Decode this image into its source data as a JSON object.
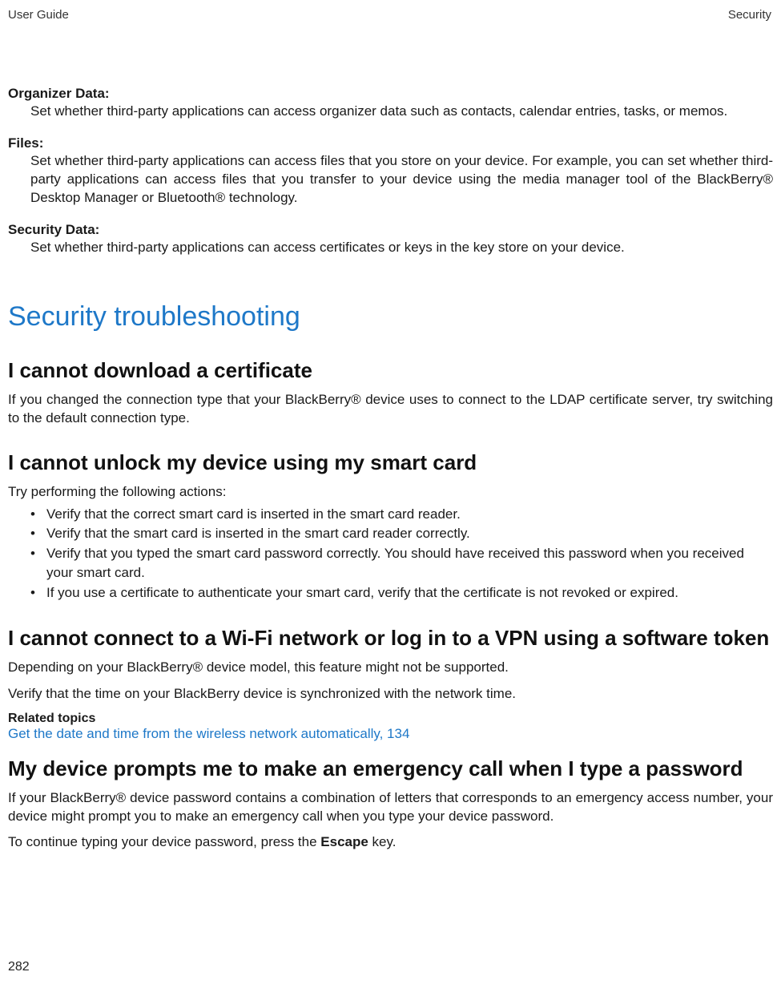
{
  "header": {
    "left": "User Guide",
    "right": "Security"
  },
  "defs": {
    "organizer": {
      "title": "Organizer Data:",
      "body": "Set whether third-party applications can access organizer data such as contacts, calendar entries, tasks, or memos."
    },
    "files": {
      "title": "Files:",
      "body": "Set whether third-party applications can access files that you store on your device. For example, you can set whether third-party applications can access files that you transfer to your device using the media manager tool of the BlackBerry® Desktop Manager or Bluetooth® technology."
    },
    "security": {
      "title": "Security Data:",
      "body": "Set whether third-party applications can access certificates or keys in the key store on your device."
    }
  },
  "section_heading": "Security troubleshooting",
  "cert": {
    "heading": "I cannot download a certificate",
    "body": "If you changed the connection type that your BlackBerry® device uses to connect to the LDAP certificate server, try switching to the default connection type."
  },
  "smartcard": {
    "heading": "I cannot unlock my device using my smart card",
    "intro": "Try performing the following actions:",
    "items": [
      "Verify that the correct smart card is inserted in the smart card reader.",
      "Verify that the smart card is inserted in the smart card reader correctly.",
      "Verify that you typed the smart card password correctly. You should have received this password when you received your smart card.",
      "If you use a certificate to authenticate your smart card, verify that the certificate is not revoked or expired."
    ]
  },
  "wifi": {
    "heading": "I cannot connect to a Wi-Fi network or log in to a VPN using a software token",
    "p1": "Depending on your BlackBerry® device model, this feature might not be supported.",
    "p2": "Verify that the time on your BlackBerry device is synchronized with the network time.",
    "related_label": "Related topics",
    "related_link": "Get the date and time from the wireless network automatically, 134"
  },
  "emergency": {
    "heading": "My device prompts me to make an emergency call when I type a password",
    "p1": "If your BlackBerry® device password contains a combination of letters that corresponds to an emergency access number, your device might prompt you to make an emergency call when you type your device password.",
    "p2_prefix": "To continue typing your device password, press the ",
    "p2_key": "Escape",
    "p2_suffix": " key."
  },
  "page_number": "282"
}
